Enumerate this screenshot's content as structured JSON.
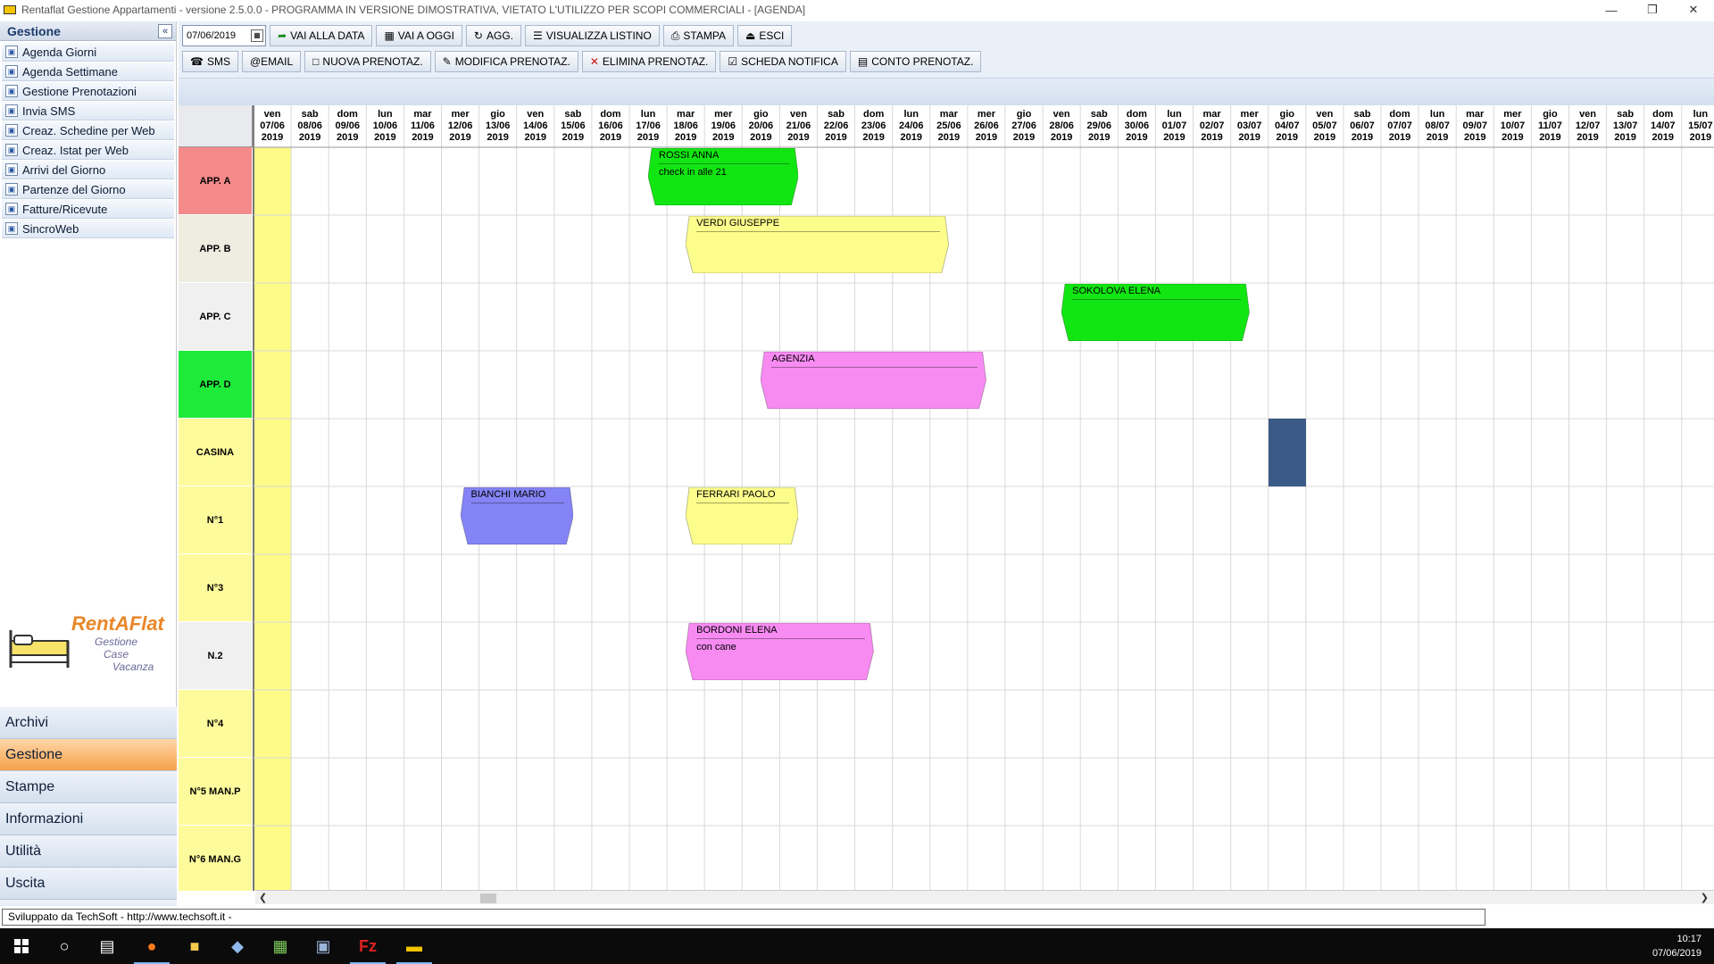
{
  "window": {
    "title": "Rentaflat Gestione Appartamenti - versione 2.5.0.0 - PROGRAMMA IN VERSIONE DIMOSTRATIVA, VIETATO L'UTILIZZO PER SCOPI COMMERCIALI - [AGENDA]"
  },
  "sidebar": {
    "title": "Gestione",
    "items": [
      {
        "label": "Agenda Giorni",
        "icon": "calendar-icon"
      },
      {
        "label": "Agenda Settimane",
        "icon": "calendar-icon"
      },
      {
        "label": "Gestione Prenotazioni",
        "icon": "booking-icon"
      },
      {
        "label": "Invia SMS",
        "icon": "phone-icon"
      },
      {
        "label": "Creaz. Schedine per Web",
        "icon": "form-icon"
      },
      {
        "label": "Creaz. Istat per Web",
        "icon": "form-icon"
      },
      {
        "label": "Arrivi del Giorno",
        "icon": "arrival-icon"
      },
      {
        "label": "Partenze del Giorno",
        "icon": "departure-icon"
      },
      {
        "label": "Fatture/Ricevute",
        "icon": "document-icon"
      },
      {
        "label": "SincroWeb",
        "icon": "sync-icon"
      }
    ],
    "logo": {
      "name": "RentAFlat",
      "line1": "Gestione",
      "line2": "Case",
      "line3": "Vacanza"
    },
    "menu": [
      {
        "label": "Archivi",
        "active": false
      },
      {
        "label": "Gestione",
        "active": true
      },
      {
        "label": "Stampe",
        "active": false
      },
      {
        "label": "Informazioni",
        "active": false
      },
      {
        "label": "Utilità",
        "active": false
      },
      {
        "label": "Uscita",
        "active": false
      }
    ]
  },
  "toolbar": {
    "date_value": "07/06/2019",
    "row1": [
      {
        "label": "VAI ALLA DATA",
        "icon": "arrow-icon"
      },
      {
        "label": "VAI A OGGI",
        "icon": "calendar-icon"
      },
      {
        "label": "AGG.",
        "icon": "refresh-icon"
      },
      {
        "label": "VISUALIZZA LISTINO",
        "icon": "list-icon"
      },
      {
        "label": "STAMPA",
        "icon": "printer-icon"
      },
      {
        "label": "ESCI",
        "icon": "exit-icon"
      }
    ],
    "row2": [
      {
        "label": "SMS",
        "icon": "phone-icon"
      },
      {
        "label": "@EMAIL",
        "icon": ""
      },
      {
        "label": "NUOVA PRENOTAZ.",
        "icon": "new-document-icon"
      },
      {
        "label": "MODIFICA PRENOTAZ.",
        "icon": "edit-icon"
      },
      {
        "label": "ELIMINA PRENOTAZ.",
        "icon": "delete-icon"
      },
      {
        "label": "SCHEDA NOTIFICA",
        "icon": "checklist-icon"
      },
      {
        "label": "CONTO PRENOTAZ.",
        "icon": "invoice-icon"
      }
    ]
  },
  "calendar": {
    "days": [
      [
        "ven",
        "07/06",
        "2019"
      ],
      [
        "sab",
        "08/06",
        "2019"
      ],
      [
        "dom",
        "09/06",
        "2019"
      ],
      [
        "lun",
        "10/06",
        "2019"
      ],
      [
        "mar",
        "11/06",
        "2019"
      ],
      [
        "mer",
        "12/06",
        "2019"
      ],
      [
        "gio",
        "13/06",
        "2019"
      ],
      [
        "ven",
        "14/06",
        "2019"
      ],
      [
        "sab",
        "15/06",
        "2019"
      ],
      [
        "dom",
        "16/06",
        "2019"
      ],
      [
        "lun",
        "17/06",
        "2019"
      ],
      [
        "mar",
        "18/06",
        "2019"
      ],
      [
        "mer",
        "19/06",
        "2019"
      ],
      [
        "gio",
        "20/06",
        "2019"
      ],
      [
        "ven",
        "21/06",
        "2019"
      ],
      [
        "sab",
        "22/06",
        "2019"
      ],
      [
        "dom",
        "23/06",
        "2019"
      ],
      [
        "lun",
        "24/06",
        "2019"
      ],
      [
        "mar",
        "25/06",
        "2019"
      ],
      [
        "mer",
        "26/06",
        "2019"
      ],
      [
        "gio",
        "27/06",
        "2019"
      ],
      [
        "ven",
        "28/06",
        "2019"
      ],
      [
        "sab",
        "29/06",
        "2019"
      ],
      [
        "dom",
        "30/06",
        "2019"
      ],
      [
        "lun",
        "01/07",
        "2019"
      ],
      [
        "mar",
        "02/07",
        "2019"
      ],
      [
        "mer",
        "03/07",
        "2019"
      ],
      [
        "gio",
        "04/07",
        "2019"
      ],
      [
        "ven",
        "05/07",
        "2019"
      ],
      [
        "sab",
        "06/07",
        "2019"
      ],
      [
        "dom",
        "07/07",
        "2019"
      ],
      [
        "lun",
        "08/07",
        "2019"
      ],
      [
        "mar",
        "09/07",
        "2019"
      ],
      [
        "mer",
        "10/07",
        "2019"
      ],
      [
        "gio",
        "11/07",
        "2019"
      ],
      [
        "ven",
        "12/07",
        "2019"
      ],
      [
        "sab",
        "13/07",
        "2019"
      ],
      [
        "dom",
        "14/07",
        "2019"
      ],
      [
        "lun",
        "15/07",
        "2019"
      ]
    ],
    "rooms": [
      {
        "label": "APP. A",
        "color": "#f48a8a"
      },
      {
        "label": "APP. B",
        "color": "#efece0"
      },
      {
        "label": "APP. C",
        "color": "#f0f0f0"
      },
      {
        "label": "APP. D",
        "color": "#1eea3a"
      },
      {
        "label": "CASINA",
        "color": "#fefb9c"
      },
      {
        "label": "N°1",
        "color": "#fefb9c"
      },
      {
        "label": "N°3",
        "color": "#fefb9c"
      },
      {
        "label": "N.2",
        "color": "#f0f0f0"
      },
      {
        "label": "N°4",
        "color": "#fefb9c"
      },
      {
        "label": "N°5 MAN.P",
        "color": "#fefb9c"
      },
      {
        "label": "N°6 MAN.G",
        "color": "#fefb9c"
      }
    ],
    "today_column_color": "#fefb88",
    "bookings": [
      {
        "room": 0,
        "from": "17/06",
        "to": "21/06",
        "name": "ROSSI ANNA",
        "note": "check in alle 21",
        "color": "#12e612"
      },
      {
        "room": 1,
        "from": "18/06",
        "to": "25/06",
        "name": "VERDI GIUSEPPE",
        "note": "",
        "color": "#fdfd8c"
      },
      {
        "room": 2,
        "from": "28/06",
        "to": "03/07",
        "name": "SOKOLOVA ELENA",
        "note": "",
        "color": "#12e612"
      },
      {
        "room": 3,
        "from": "20/06",
        "to": "26/06",
        "name": "AGENZIA",
        "note": "",
        "color": "#f78bf2"
      },
      {
        "room": 5,
        "from": "12/06",
        "to": "15/06",
        "name": "BIANCHI  MARIO",
        "note": "",
        "color": "#8484f6"
      },
      {
        "room": 5,
        "from": "18/06",
        "to": "21/06",
        "name": "FERRARI PAOLO",
        "note": "",
        "color": "#fdfd8c"
      },
      {
        "room": 7,
        "from": "18/06",
        "to": "23/06",
        "name": "BORDONI ELENA",
        "note": "con cane",
        "color": "#f78bf2"
      }
    ],
    "blocks": [
      {
        "room": 4,
        "date": "04/07",
        "color": "#3b5a86"
      }
    ]
  },
  "status": {
    "text": "Sviluppato da TechSoft - http://www.techsoft.it -"
  },
  "taskbar": {
    "time": "10:17",
    "date": "07/06/2019"
  }
}
